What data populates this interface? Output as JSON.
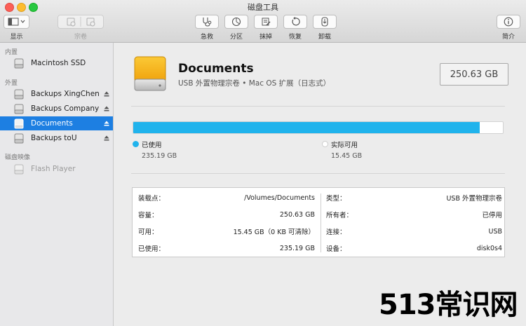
{
  "window": {
    "title": "磁盘工具"
  },
  "toolbar": {
    "show_label": "显示",
    "volume_label": "宗卷",
    "first_aid_label": "急救",
    "partition_label": "分区",
    "erase_label": "抹掉",
    "restore_label": "恢复",
    "unmount_label": "卸载",
    "info_label": "简介"
  },
  "sidebar": {
    "sections": {
      "internal": "内置",
      "external": "外置",
      "images": "磁盘映像"
    },
    "items": [
      {
        "label": "Macintosh SSD"
      },
      {
        "label": "Backups XingChen"
      },
      {
        "label": "Backups Company"
      },
      {
        "label": "Documents"
      },
      {
        "label": "Backups toU"
      },
      {
        "label": "Flash Player"
      }
    ]
  },
  "volume": {
    "name": "Documents",
    "subtitle": "USB 外置物理宗卷 • Mac OS 扩展（日志式）",
    "size": "250.63 GB"
  },
  "usage": {
    "used_fraction": 0.938,
    "used_color": "#20b3ec",
    "free_color": "#ffffff",
    "used_label": "已使用",
    "used_value": "235.19 GB",
    "free_label": "实际可用",
    "free_value": "15.45 GB"
  },
  "info": {
    "left": [
      {
        "key": "装载点：",
        "value": "/Volumes/Documents"
      },
      {
        "key": "容量：",
        "value": "250.63 GB"
      },
      {
        "key": "可用：",
        "value": "15.45 GB（0 KB 可清除）"
      },
      {
        "key": "已使用：",
        "value": "235.19 GB"
      }
    ],
    "right": [
      {
        "key": "类型：",
        "value": "USB 外置物理宗卷"
      },
      {
        "key": "所有者：",
        "value": "已停用"
      },
      {
        "key": "连接：",
        "value": "USB"
      },
      {
        "key": "设备：",
        "value": "disk0s4"
      }
    ]
  },
  "watermark": {
    "text": "513常识网"
  }
}
